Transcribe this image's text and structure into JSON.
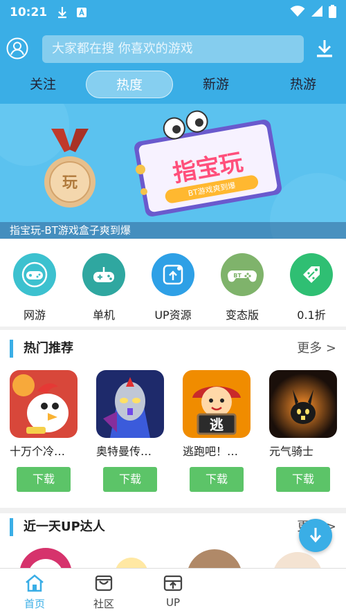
{
  "status_bar": {
    "time": "10:21"
  },
  "search": {
    "placeholder": "大家都在搜  你喜欢的游戏"
  },
  "tabs": [
    {
      "label": "关注"
    },
    {
      "label": "热度",
      "active": true
    },
    {
      "label": "新游"
    },
    {
      "label": "热游"
    }
  ],
  "banner": {
    "caption": "指宝玩-BT游戏盒子爽到爆",
    "logo_text": "指宝玩",
    "ribbon_text": "BT游戏爽到爆",
    "medal_text": "玩"
  },
  "categories": [
    {
      "label": "网游",
      "color": "#3cc1cf"
    },
    {
      "label": "单机",
      "color": "#2fa7a0"
    },
    {
      "label": "UP资源",
      "color": "#2ea0e6"
    },
    {
      "label": "变态版",
      "color": "#7fb36b"
    },
    {
      "label": "0.1折",
      "color": "#2fbf73"
    }
  ],
  "hot": {
    "title": "热门推荐",
    "more": "更多 >",
    "games": [
      {
        "name": "十万个冷…",
        "button": "下载"
      },
      {
        "name": "奥特曼传…",
        "button": "下载"
      },
      {
        "name": "逃跑吧！…",
        "button": "下载",
        "thumb_text": "逃"
      },
      {
        "name": "元气骑士",
        "button": "下载"
      }
    ]
  },
  "up": {
    "title": "近一天UP达人",
    "more": "更多 >"
  },
  "bottom_nav": [
    {
      "label": "首页",
      "active": true
    },
    {
      "label": "社区"
    },
    {
      "label": "UP"
    }
  ],
  "colors": {
    "primary": "#3aaee6",
    "download_button": "#5cc468"
  }
}
